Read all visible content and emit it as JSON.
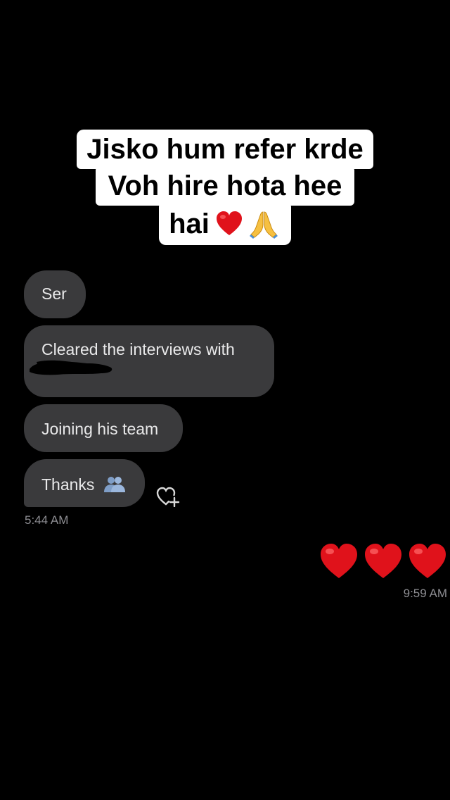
{
  "caption": {
    "line1": "Jisko hum refer krde",
    "line2": "Voh hire hota hee",
    "line3": "hai"
  },
  "received_messages": [
    {
      "text": "Ser"
    },
    {
      "text": "Cleared the interviews with"
    },
    {
      "text": "Joining his team"
    },
    {
      "text": "Thanks"
    }
  ],
  "received_time": "5:44 AM",
  "sent_time": "9:59 AM",
  "icons": {
    "caption_heart": "red-heart-icon",
    "caption_pray": "folded-hands-icon",
    "thanks_emoji": "people-icon",
    "reaction": "add-reaction-heart-icon",
    "sent_hearts": [
      "red-heart-icon",
      "red-heart-icon",
      "red-heart-icon"
    ]
  },
  "colors": {
    "background": "#000000",
    "bubble": "#3a3a3c",
    "timestamp": "#8e8e93",
    "heart": "#e0121b"
  }
}
